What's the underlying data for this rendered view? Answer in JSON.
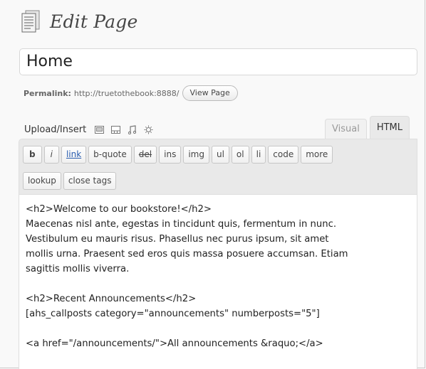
{
  "header": {
    "title": "Edit Page",
    "icon": "page-icon"
  },
  "title_field": {
    "value": "Home"
  },
  "permalink": {
    "label": "Permalink:",
    "url": "http://truetothebook:8888/",
    "view_button": "View Page"
  },
  "media": {
    "label": "Upload/Insert",
    "icons": [
      "image-icon",
      "video-icon",
      "audio-icon",
      "media-icon"
    ]
  },
  "tabs": {
    "visual": "Visual",
    "html": "HTML",
    "active": "HTML"
  },
  "quicktags": {
    "row1": [
      "b",
      "i",
      "link",
      "b-quote",
      "del",
      "ins",
      "img",
      "ul",
      "ol",
      "li",
      "code",
      "more"
    ],
    "row2": [
      "lookup",
      "close tags"
    ]
  },
  "editor": {
    "lines": [
      "<h2>Welcome to our bookstore!</h2>",
      "Maecenas nisl ante, egestas in tincidunt quis, fermentum in nunc.",
      "Vestibulum eu mauris risus. Phasellus nec purus ipsum, sit amet",
      "mollis urna. Praesent sed eros quis massa posuere accumsan. Etiam",
      "sagittis mollis viverra.",
      "",
      "<h2>Recent Announcements</h2>",
      "[ahs_callposts category=\"announcements\" numberposts=\"5\"]",
      "",
      "<a href=\"/announcements/\">All announcements &raquo;</a>"
    ]
  }
}
